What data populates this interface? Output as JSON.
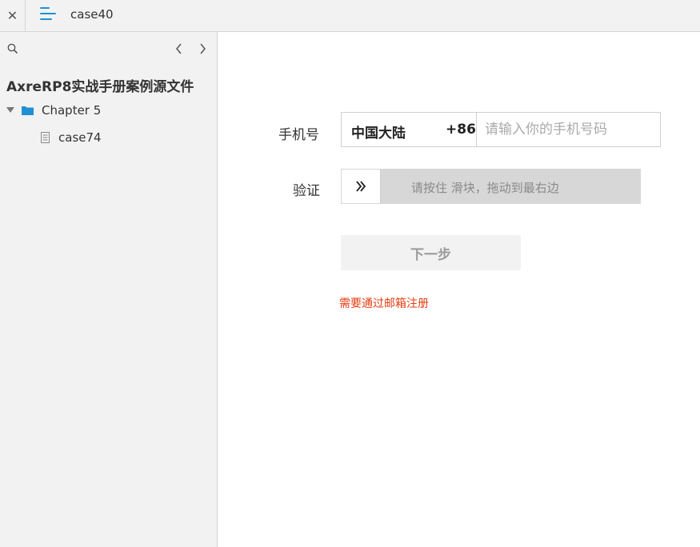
{
  "topbar": {
    "close_glyph": "✕",
    "page_title": "case40"
  },
  "sidebar": {
    "project_title": "AxreRP8实战手册案例源文件",
    "tree": {
      "folder": {
        "label": "Chapter 5",
        "icon": "folder-icon",
        "color": "#1e90d6"
      },
      "page": {
        "label": "case74",
        "icon": "page-icon"
      }
    }
  },
  "form": {
    "phone_label": "手机号",
    "country_name": "中国大陆",
    "country_code": "+86",
    "phone_placeholder": "请输入你的手机号码",
    "verify_label": "验证",
    "slider_hint": "请按住 滑块，拖动到最右边",
    "next_label": "下一步",
    "email_register_link": "需要通过邮箱注册",
    "accent_color": "#1e90d6",
    "link_color": "#e63d12"
  }
}
